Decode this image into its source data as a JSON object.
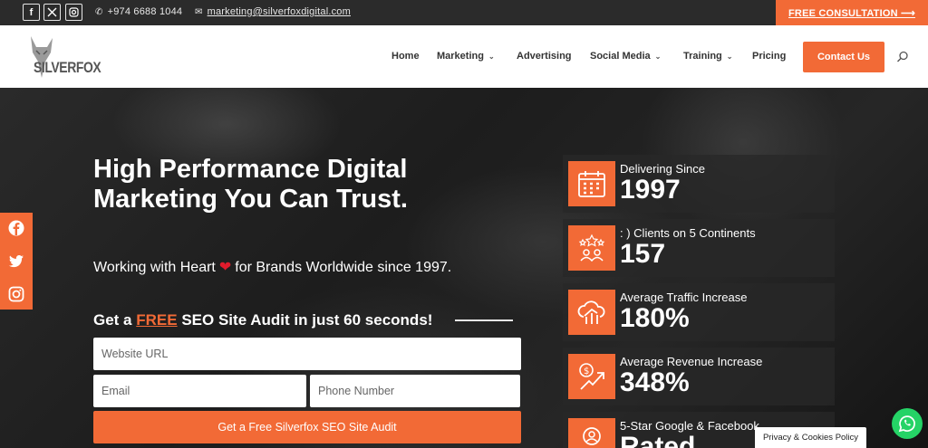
{
  "topbar": {
    "social": [
      {
        "icon": "facebook-icon",
        "glyph": "f"
      },
      {
        "icon": "x-twitter-icon",
        "glyph": "𝕏"
      },
      {
        "icon": "instagram-icon",
        "glyph": "◎"
      }
    ],
    "phone": "+974 6688 1044",
    "email": "marketing@silverfoxdigital.com",
    "cta": "FREE CONSULTATION ⟶"
  },
  "nav": {
    "logo_text": "SILVERFOX",
    "items": [
      {
        "label": "Home",
        "dropdown": false
      },
      {
        "label": "Marketing",
        "dropdown": true
      },
      {
        "label": "Advertising",
        "dropdown": false
      },
      {
        "label": "Social Media",
        "dropdown": true
      },
      {
        "label": "Training",
        "dropdown": true
      },
      {
        "label": "Pricing",
        "dropdown": false
      }
    ],
    "contact_button": "Contact Us"
  },
  "hero": {
    "title": "High Performance Digital Marketing You Can Trust.",
    "subtitle_before": "Working with Heart",
    "subtitle_after": "for Brands Worldwide since 1997.",
    "audit_prefix": "Get a",
    "audit_free": "FREE",
    "audit_suffix": "SEO Site Audit in just 60 seconds!",
    "form": {
      "url_placeholder": "Website URL",
      "email_placeholder": "Email",
      "phone_placeholder": "Phone Number",
      "submit": "Get a Free Silverfox SEO Site Audit"
    }
  },
  "stats": [
    {
      "label": "Delivering Since",
      "value": "1997",
      "icon": "calendar-icon"
    },
    {
      "label": ": ) Clients on 5 Continents",
      "value": "157",
      "icon": "clients-stars-icon"
    },
    {
      "label": "Average Traffic Increase",
      "value": "180%",
      "icon": "cloud-growth-icon"
    },
    {
      "label": "Average Revenue Increase",
      "value": "348%",
      "icon": "revenue-growth-icon"
    },
    {
      "label": "5-Star Google & Facebook",
      "value": "Rated",
      "icon": "rated-user-icon"
    }
  ],
  "privacy_label": "Privacy & Cookies Policy",
  "colors": {
    "accent": "#f26a36",
    "dark": "#2b2b2b",
    "whatsapp": "#25d366"
  }
}
